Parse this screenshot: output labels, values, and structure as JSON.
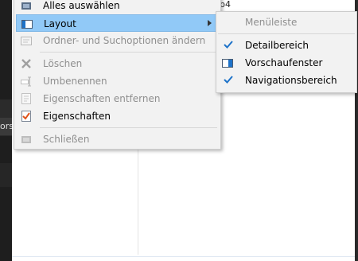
{
  "background": {
    "left_tag": "ors",
    "top_text": "p4"
  },
  "main_menu": {
    "items": [
      {
        "label": "Alles auswählen",
        "disabled": false
      },
      {
        "label": "Layout",
        "disabled": false,
        "highlighted": true,
        "submenu": true
      },
      {
        "label": "Ordner- und Suchoptionen ändern",
        "disabled": true
      },
      {
        "label": "Löschen",
        "disabled": true
      },
      {
        "label": "Umbenennen",
        "disabled": true
      },
      {
        "label": "Eigenschaften entfernen",
        "disabled": true
      },
      {
        "label": "Eigenschaften",
        "disabled": false
      },
      {
        "label": "Schließen",
        "disabled": true
      }
    ]
  },
  "sub_menu": {
    "items": [
      {
        "label": "Menüleiste",
        "disabled": true,
        "checked": false
      },
      {
        "label": "Detailbereich",
        "disabled": false,
        "checked": true
      },
      {
        "label": "Vorschaufenster",
        "disabled": false,
        "checked": false
      },
      {
        "label": "Navigationsbereich",
        "disabled": false,
        "checked": true
      }
    ]
  },
  "colors": {
    "menu_bg": "#f2f2f2",
    "highlight": "#91c9f7",
    "accent": "#1e73c9",
    "disabled_text": "#8f8f8f"
  }
}
